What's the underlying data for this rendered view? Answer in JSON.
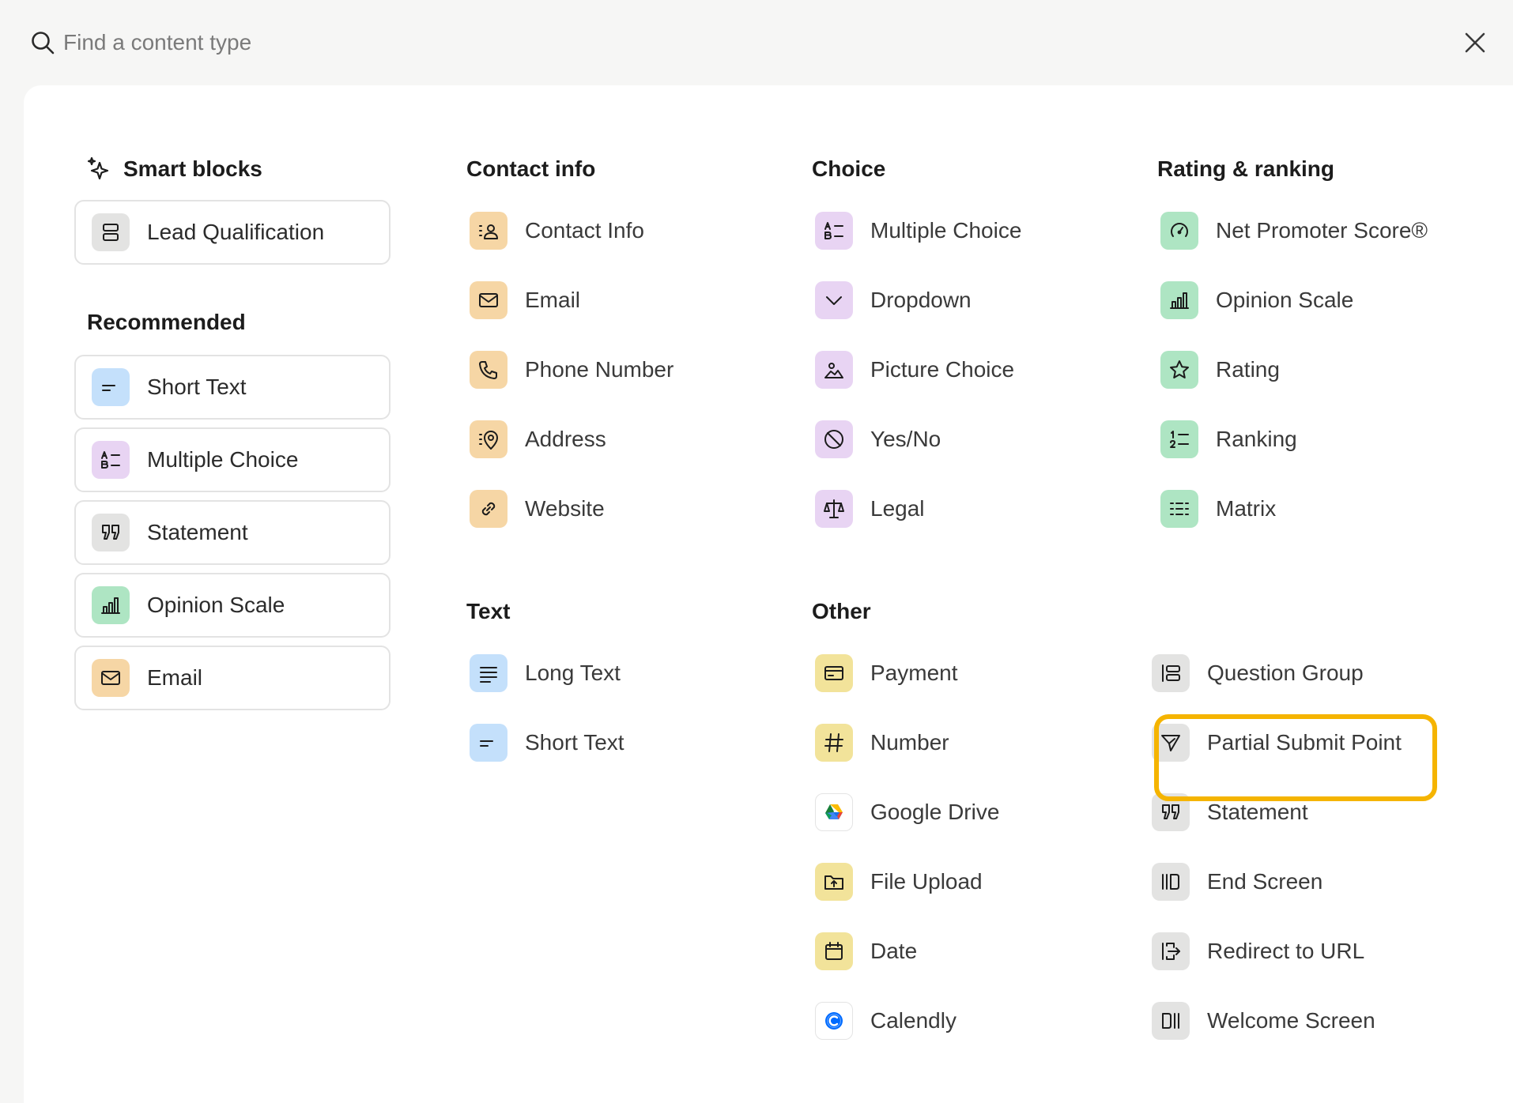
{
  "search": {
    "placeholder": "Find a content type",
    "value": ""
  },
  "colors": {
    "gray": "#e3e3e2",
    "blue": "#c4e0fb",
    "purple": "#e8d4f3",
    "green": "#aee5c3",
    "orange": "#f6d6a5",
    "yellow": "#f2e39a",
    "highlight": "#f5b400"
  },
  "smart_blocks": {
    "heading": "Smart blocks",
    "items": [
      {
        "label": "Lead Qualification",
        "icon": "lead-qualification-icon",
        "color": "gray"
      }
    ]
  },
  "recommended": {
    "heading": "Recommended",
    "items": [
      {
        "label": "Short Text",
        "icon": "short-text-icon",
        "color": "blue"
      },
      {
        "label": "Multiple Choice",
        "icon": "multiple-choice-icon",
        "color": "purple"
      },
      {
        "label": "Statement",
        "icon": "quote-icon",
        "color": "gray"
      },
      {
        "label": "Opinion Scale",
        "icon": "opinion-scale-icon",
        "color": "green"
      },
      {
        "label": "Email",
        "icon": "email-icon",
        "color": "orange"
      }
    ]
  },
  "contact_info": {
    "heading": "Contact info",
    "items": [
      {
        "label": "Contact Info",
        "icon": "contact-info-icon",
        "color": "orange"
      },
      {
        "label": "Email",
        "icon": "email-icon",
        "color": "orange"
      },
      {
        "label": "Phone Number",
        "icon": "phone-icon",
        "color": "orange"
      },
      {
        "label": "Address",
        "icon": "address-icon",
        "color": "orange"
      },
      {
        "label": "Website",
        "icon": "link-icon",
        "color": "orange"
      }
    ]
  },
  "text": {
    "heading": "Text",
    "items": [
      {
        "label": "Long Text",
        "icon": "long-text-icon",
        "color": "blue"
      },
      {
        "label": "Short Text",
        "icon": "short-text-icon",
        "color": "blue"
      }
    ]
  },
  "choice": {
    "heading": "Choice",
    "items": [
      {
        "label": "Multiple Choice",
        "icon": "multiple-choice-icon",
        "color": "purple"
      },
      {
        "label": "Dropdown",
        "icon": "chevron-down-icon",
        "color": "purple"
      },
      {
        "label": "Picture Choice",
        "icon": "picture-icon",
        "color": "purple"
      },
      {
        "label": "Yes/No",
        "icon": "yes-no-icon",
        "color": "purple"
      },
      {
        "label": "Legal",
        "icon": "scales-icon",
        "color": "purple"
      }
    ]
  },
  "other": {
    "heading": "Other",
    "items": [
      {
        "label": "Payment",
        "icon": "payment-card-icon",
        "color": "yellow"
      },
      {
        "label": "Number",
        "icon": "hash-icon",
        "color": "yellow"
      },
      {
        "label": "Google Drive",
        "icon": "google-drive-icon",
        "color": "plain"
      },
      {
        "label": "File Upload",
        "icon": "file-upload-icon",
        "color": "yellow"
      },
      {
        "label": "Date",
        "icon": "calendar-icon",
        "color": "yellow"
      },
      {
        "label": "Calendly",
        "icon": "calendly-icon",
        "color": "plain"
      }
    ]
  },
  "rating_ranking": {
    "heading": "Rating & ranking",
    "items": [
      {
        "label": "Net Promoter Score®",
        "icon": "gauge-icon",
        "color": "green"
      },
      {
        "label": "Opinion Scale",
        "icon": "opinion-scale-icon",
        "color": "green"
      },
      {
        "label": "Rating",
        "icon": "star-icon",
        "color": "green"
      },
      {
        "label": "Ranking",
        "icon": "ranking-icon",
        "color": "green"
      },
      {
        "label": "Matrix",
        "icon": "matrix-icon",
        "color": "green"
      }
    ]
  },
  "structure": {
    "items": [
      {
        "label": "Question Group",
        "icon": "question-group-icon",
        "color": "gray",
        "highlighted": true
      },
      {
        "label": "Partial Submit Point",
        "icon": "send-icon",
        "color": "gray"
      },
      {
        "label": "Statement",
        "icon": "quote-icon",
        "color": "gray"
      },
      {
        "label": "End Screen",
        "icon": "end-screen-icon",
        "color": "gray"
      },
      {
        "label": "Redirect to URL",
        "icon": "redirect-icon",
        "color": "gray"
      },
      {
        "label": "Welcome Screen",
        "icon": "welcome-screen-icon",
        "color": "gray"
      }
    ]
  }
}
